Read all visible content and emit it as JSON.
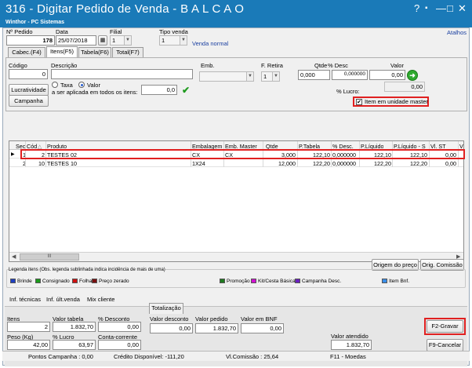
{
  "window": {
    "title": "316 - Digitar Pedido de Venda - B A L C A O",
    "subtitle": "Winthor - PC Sistemas",
    "controls": [
      "?",
      "▪",
      "—",
      "□",
      "✕"
    ]
  },
  "header": {
    "numero_pedido_label": "Nº Pedido",
    "numero_pedido": "178",
    "data_label": "Data",
    "data": "25/07/2018",
    "calendar_icon": "calendar-icon",
    "filial_label": "Filial",
    "filial": "1",
    "tipo_venda_label": "Tipo venda",
    "tipo_venda": "1",
    "tipo_venda_desc": "Venda normal",
    "atalhos": "Atalhos"
  },
  "tabs": [
    "Cabec.(F4)",
    "Itens(F5)",
    "Tabela(F6)",
    "Total(F7)"
  ],
  "item_entry": {
    "codigo_label": "Código",
    "codigo": "0",
    "descricao_label": "Descrição",
    "emb_label": "Emb.",
    "f_retira_label": "F. Retira",
    "f_retira": "1",
    "qtde_label": "Qtde",
    "qtde": "0,000",
    "desc_label": "% Desc",
    "desc": "0,000000",
    "valor_label": "Valor",
    "valor": "0,00",
    "lucro_label": "% Lucro:",
    "lucro": "0,00",
    "lucratividade_btn": "Lucratividade",
    "campanha_btn": "Campanha",
    "taxa_label": "Taxa",
    "valor_radio_label": "Valor",
    "aplicada_label": "a ser aplicada em todos os itens:",
    "aplicada_value": "0,0",
    "item_unidade_master": "Item em unidade master"
  },
  "grid": {
    "columns": [
      "Sec",
      "Cód",
      "Produto",
      "Embalagem",
      "Emb. Master",
      "Qtde",
      "P.Tabela",
      "% Desc.",
      "P.Líquido",
      "P.Líquido - S",
      "Vl. ST",
      "Vl"
    ],
    "rows": [
      {
        "sec": "1",
        "cod": "2",
        "produto": "TESTES 02",
        "embalagem": "CX",
        "emb_master": "CX",
        "qtde": "3,000",
        "p_tabela": "122,10",
        "desc": "0,000000",
        "p_liquido": "122,10",
        "p_liquido_s": "122,10",
        "vl_st": "0,00"
      },
      {
        "sec": "2",
        "cod": "10",
        "produto": "TESTES 10",
        "embalagem": "1X24",
        "emb_master": "",
        "qtde": "12,000",
        "p_tabela": "122,20",
        "desc": "0,000000",
        "p_liquido": "122,20",
        "p_liquido_s": "122,20",
        "vl_st": "0,00"
      }
    ],
    "scroll_marker": "III"
  },
  "actions": {
    "origem_preco": "Origem do preço",
    "orig_comissao": "Orig. Comissão"
  },
  "legend": {
    "title": "Legenda itens (Obs. legenda sublinhada indica incidência de mais de uma)",
    "items": [
      {
        "label": "Brinde",
        "color": "#1e3fc0"
      },
      {
        "label": "Consignado",
        "color": "#1a9a1a"
      },
      {
        "label": "Folha",
        "color": "#d01010"
      },
      {
        "label": "Preço zerado",
        "color": "#7a1010"
      },
      {
        "label": "Promoção",
        "color": "#1f7a1f"
      },
      {
        "label": "Kit/Cesta Básica",
        "color": "#d010d0"
      },
      {
        "label": "Campanha Desc.",
        "color": "#6a1fc0"
      },
      {
        "label": "Item Bnf.",
        "color": "#3a8ee8"
      }
    ]
  },
  "info_tabs": [
    "Inf. técnicas",
    "Inf. últ.venda",
    "Mix cliente"
  ],
  "totals": {
    "tab_label": "Totalização",
    "itens_label": "Itens",
    "itens": "2",
    "valor_tabela_label": "Valor tabela",
    "valor_tabela": "1.832,70",
    "pct_desconto_label": "% Desconto",
    "pct_desconto": "0,00",
    "valor_desconto_label": "Valor desconto",
    "valor_desconto": "0,00",
    "valor_pedido_label": "Valor pedido",
    "valor_pedido": "1.832,70",
    "valor_bnf_label": "Valor em BNF",
    "valor_bnf": "0,00",
    "peso_label": "Peso (Kg)",
    "peso": "42,00",
    "pct_lucro_label": "% Lucro",
    "pct_lucro": "63,97",
    "conta_corrente_label": "Conta-corrente",
    "conta_corrente": "0,00",
    "valor_atendido_label": "Valor atendido",
    "valor_atendido": "1.832,70",
    "gravar_btn": "F2-Gravar",
    "cancelar_btn": "F9-Cancelar"
  },
  "status_bar": {
    "pontos": "Pontos Campanha : 0,00",
    "credito": "Crédito Disponível: -111,20",
    "comissao": "Vl.Comissão : 25,64",
    "moedas": "F11 - Moedas"
  }
}
